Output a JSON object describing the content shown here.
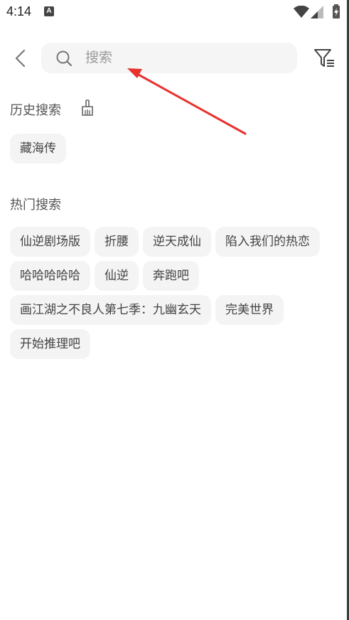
{
  "status_bar": {
    "time": "4:14",
    "notification_icon": "A"
  },
  "search": {
    "placeholder": "搜索"
  },
  "history": {
    "title": "历史搜索",
    "items": [
      "藏海传"
    ]
  },
  "hot": {
    "title": "热门搜索",
    "items": [
      "仙逆剧场版",
      "折腰",
      "逆天成仙",
      "陷入我们的热恋",
      "哈哈哈哈哈",
      "仙逆",
      "奔跑吧",
      "画江湖之不良人第七季：九幽玄天",
      "完美世界",
      "开始推理吧"
    ]
  },
  "colors": {
    "annotation_arrow": "#e8322e",
    "chip_bg": "#f4f4f4",
    "search_bg": "#f5f5f5"
  }
}
